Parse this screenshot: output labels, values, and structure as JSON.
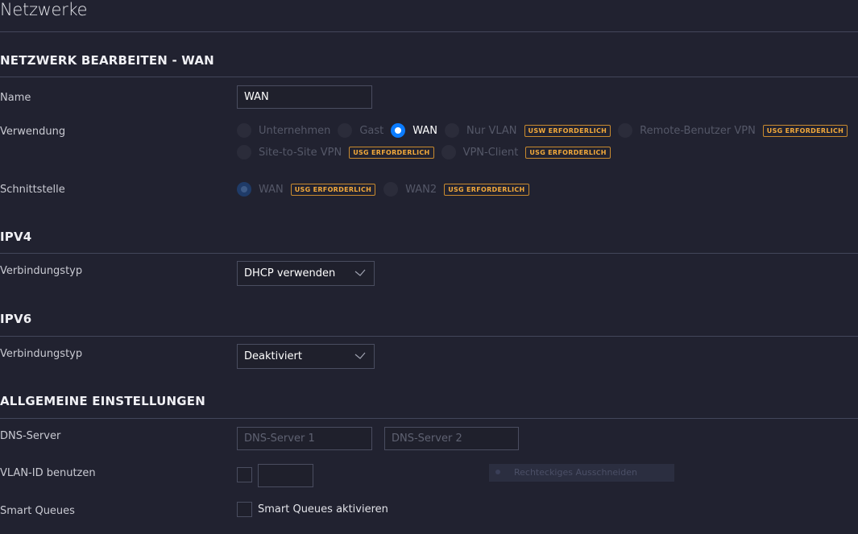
{
  "page": {
    "title": "Netzwerke"
  },
  "sections": {
    "edit": "NETZWERK BEARBEITEN - WAN",
    "ipv4": "IPV4",
    "ipv6": "IPV6",
    "general": "ALLGEMEINE EINSTELLUNGEN"
  },
  "name": {
    "label": "Name",
    "value": "WAN"
  },
  "usage": {
    "label": "Verwendung",
    "selected": "WAN",
    "options": [
      {
        "label": "Unternehmen"
      },
      {
        "label": "Gast"
      },
      {
        "label": "WAN"
      },
      {
        "label": "Nur VLAN",
        "badge": "USW ERFORDERLICH"
      },
      {
        "label": "Remote-Benutzer VPN",
        "badge": "USG ERFORDERLICH"
      },
      {
        "label": "Site-to-Site VPN",
        "badge": "USG ERFORDERLICH"
      },
      {
        "label": "VPN-Client",
        "badge": "USG ERFORDERLICH"
      }
    ]
  },
  "interface": {
    "label": "Schnittstelle",
    "selected": "WAN",
    "options": [
      {
        "label": "WAN",
        "badge": "USG ERFORDERLICH"
      },
      {
        "label": "WAN2",
        "badge": "USG ERFORDERLICH"
      }
    ]
  },
  "ipv4": {
    "label": "Verbindungstyp",
    "value": "DHCP verwenden"
  },
  "ipv6": {
    "label": "Verbindungstyp",
    "value": "Deaktiviert"
  },
  "dns": {
    "label": "DNS-Server",
    "placeholder1": "DNS-Server 1",
    "placeholder2": "DNS-Server 2"
  },
  "vlan": {
    "label": "VLAN-ID benutzen",
    "checked": false
  },
  "smart_queues": {
    "label": "Smart Queues",
    "checkbox_label": "Smart Queues aktivieren",
    "checked": false
  },
  "overlay": {
    "text": "Rechteckiges Ausschneiden"
  },
  "colors": {
    "background": "#212230",
    "accent": "#0b7cff",
    "badge": "#f2a93b",
    "divider": "#43465a"
  },
  "icons": {
    "select": "chevron-down-icon"
  }
}
